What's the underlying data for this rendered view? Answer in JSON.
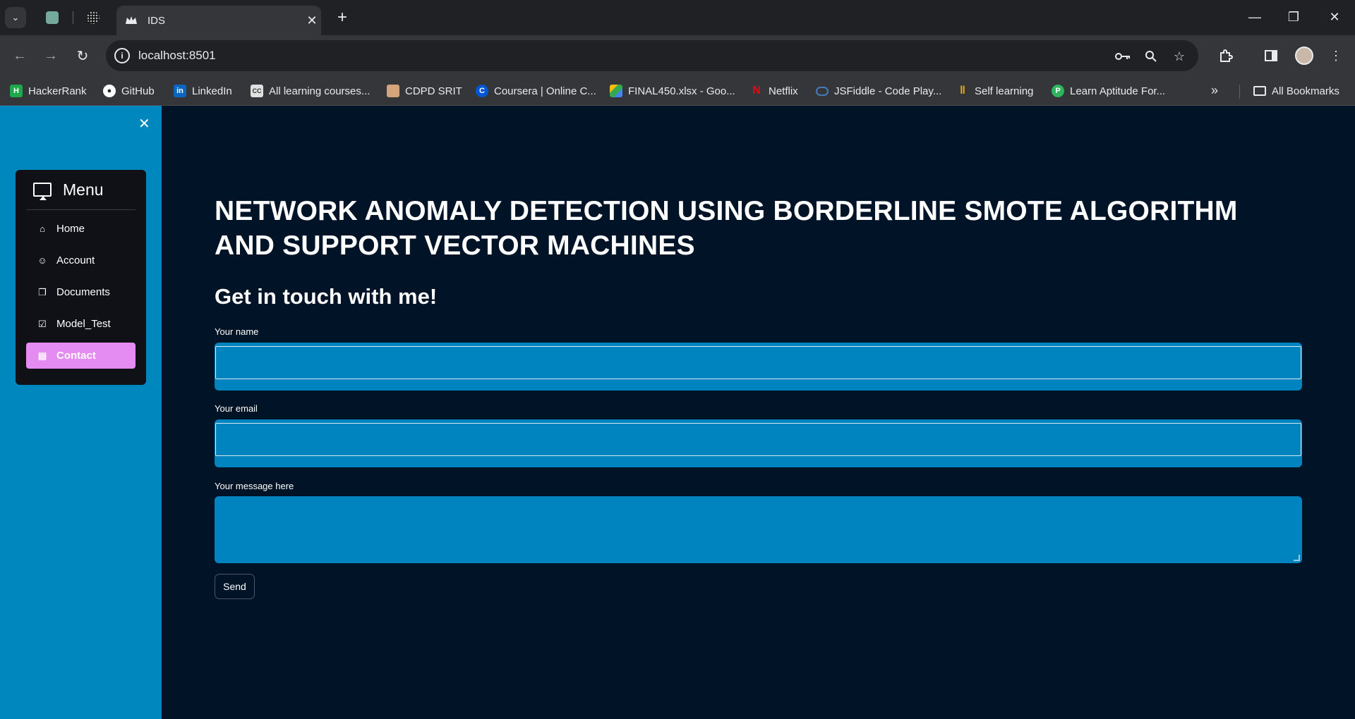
{
  "browser": {
    "tab_title": "IDS",
    "url": "localhost:8501",
    "bookmarks": [
      {
        "label": "HackerRank",
        "icon": "hackerrank-icon",
        "color": "#1ba94c"
      },
      {
        "label": "GitHub",
        "icon": "github-icon",
        "color": "#ffffff"
      },
      {
        "label": "LinkedIn",
        "icon": "linkedin-icon",
        "color": "#0a66c2"
      },
      {
        "label": "All learning courses...",
        "icon": "cc-icon",
        "color": "#e0e0e0"
      },
      {
        "label": "CDPD SRIT",
        "icon": "cdpd-icon",
        "color": "#d4a57a"
      },
      {
        "label": "Coursera | Online C...",
        "icon": "coursera-icon",
        "color": "#0056d2"
      },
      {
        "label": "FINAL450.xlsx - Goo...",
        "icon": "google-drive-icon",
        "color": "#34a853"
      },
      {
        "label": "Netflix",
        "icon": "netflix-icon",
        "color": "#e50914"
      },
      {
        "label": "JSFiddle - Code Play...",
        "icon": "jsfiddle-icon",
        "color": "#4679bd"
      },
      {
        "label": "Self learning",
        "icon": "self-learning-icon",
        "color": "#f9ab00"
      },
      {
        "label": "Learn Aptitude For...",
        "icon": "aptitude-icon",
        "color": "#2db55d"
      }
    ],
    "all_bookmarks": "All Bookmarks"
  },
  "sidebar": {
    "menu_title": "Menu",
    "items": [
      {
        "label": "Home",
        "icon": "house-icon"
      },
      {
        "label": "Account",
        "icon": "person-circle-icon"
      },
      {
        "label": "Documents",
        "icon": "files-icon"
      },
      {
        "label": "Model_Test",
        "icon": "check-square-icon"
      },
      {
        "label": "Contact",
        "icon": "contact-card-icon",
        "active": true
      }
    ],
    "active_color": "#e58cf3",
    "background": "#0087bd"
  },
  "main": {
    "title": "NETWORK ANOMALY DETECTION USING BORDERLINE SMOTE ALGORITHM AND SUPPORT VECTOR MACHINES",
    "subtitle": "Get in touch with me!",
    "form": {
      "name_label": "Your name",
      "name_value": "",
      "email_label": "Your email",
      "email_value": "",
      "message_label": "Your message here",
      "message_value": "",
      "send_label": "Send"
    },
    "background": "#011327"
  }
}
